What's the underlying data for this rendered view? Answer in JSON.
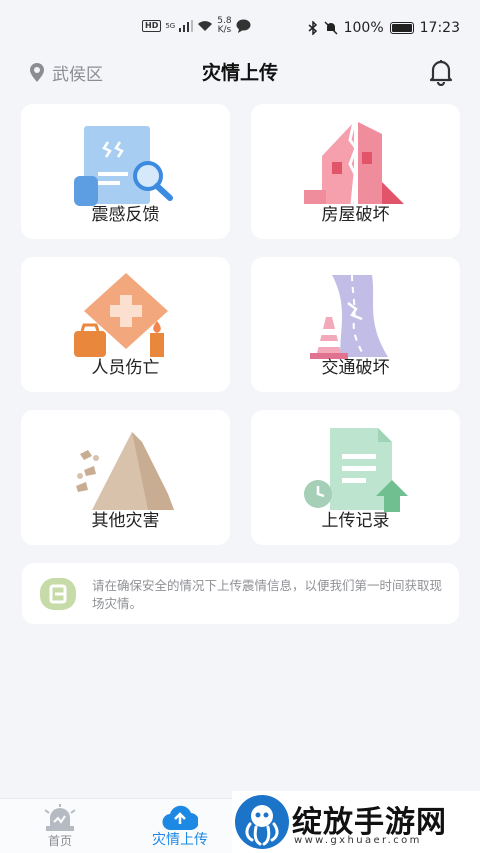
{
  "status_bar": {
    "hd": "HD",
    "signal": "5G",
    "speed_value": "5.8",
    "speed_unit": "K/s",
    "battery": "100%",
    "time": "17:23"
  },
  "header": {
    "location": "武侯区",
    "title": "灾情上传"
  },
  "cards": [
    {
      "label": "震感反馈",
      "icon": "earthquake-feeling-icon"
    },
    {
      "label": "房屋破坏",
      "icon": "house-damage-icon"
    },
    {
      "label": "人员伤亡",
      "icon": "casualty-icon"
    },
    {
      "label": "交通破坏",
      "icon": "traffic-damage-icon"
    },
    {
      "label": "其他灾害",
      "icon": "landslide-icon"
    },
    {
      "label": "上传记录",
      "icon": "upload-record-icon"
    }
  ],
  "notice": {
    "text": "请在确保安全的情况下上传震情信息，以便我们第一时间获取现场灾情。"
  },
  "tabbar": {
    "tabs": [
      {
        "label": "首页",
        "icon": "alarm-light-icon",
        "active": false
      },
      {
        "label": "灾情上传",
        "icon": "cloud-upload-icon",
        "active": true
      }
    ]
  },
  "watermark": {
    "text": "绽放手游网",
    "url": "www.gxhuaer.com"
  },
  "colors": {
    "accent": "#1e88e5",
    "background": "#f4f5f9",
    "card": "#ffffff",
    "muted_text": "#8f9196"
  }
}
